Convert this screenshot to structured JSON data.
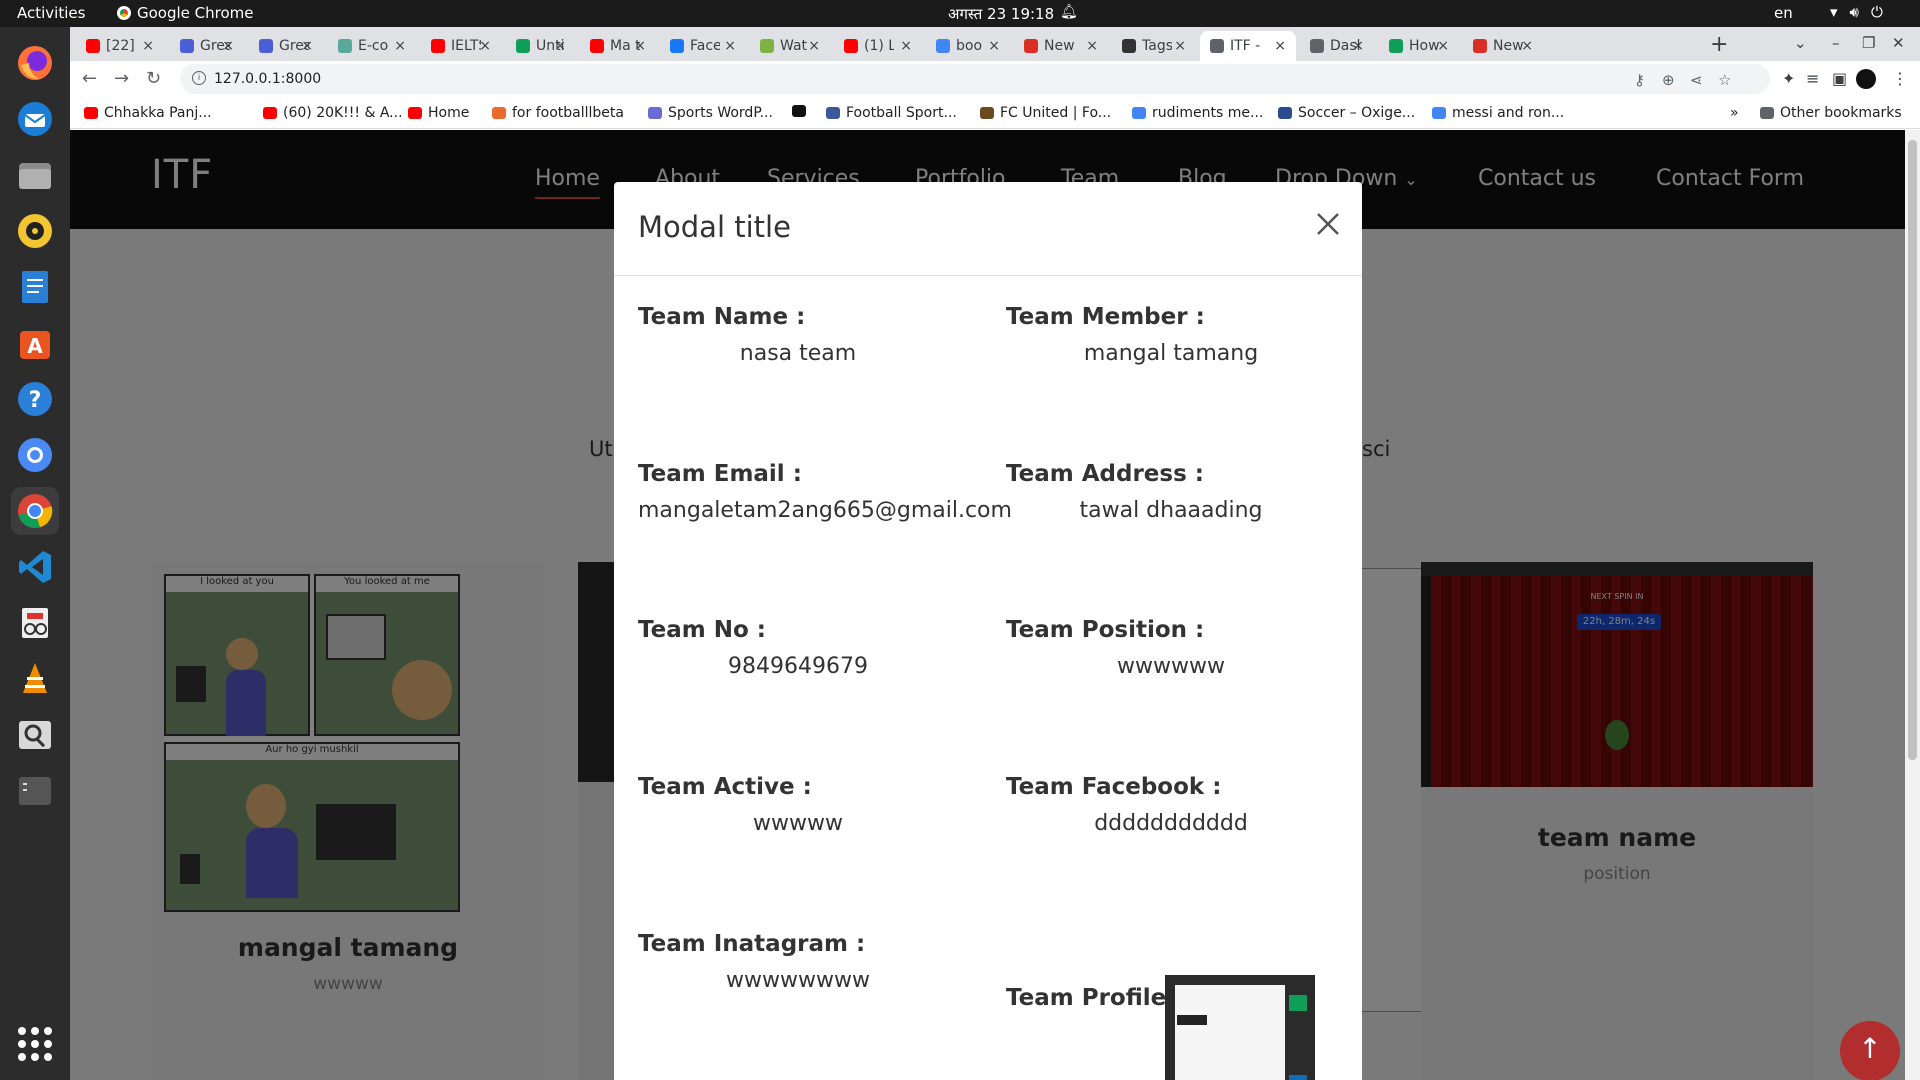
{
  "topbar": {
    "activities": "Activities",
    "app_name": "Google Chrome",
    "clock": "अगस्त 23  19:18",
    "lang": "en"
  },
  "tabs": [
    {
      "label": "[22]",
      "color": "#ff0000"
    },
    {
      "label": "Grea",
      "color": "#4a5fd6"
    },
    {
      "label": "Grea",
      "color": "#4a5fd6"
    },
    {
      "label": "E-co",
      "color": "#5aa89a"
    },
    {
      "label": "IELTS",
      "color": "#ff0000"
    },
    {
      "label": "Unti",
      "color": "#0f9d58"
    },
    {
      "label": "Ma t",
      "color": "#ff0000"
    },
    {
      "label": "Face",
      "color": "#1877f2"
    },
    {
      "label": "Wat",
      "color": "#7cb342"
    },
    {
      "label": "(1) L",
      "color": "#ff0000"
    },
    {
      "label": "boo",
      "color": "#4285f4"
    },
    {
      "label": "New",
      "color": "#d93025"
    },
    {
      "label": "Tags",
      "color": "#333333"
    },
    {
      "label": "ITF -",
      "color": "#5f6368"
    },
    {
      "label": "Dash",
      "color": "#5f6368"
    },
    {
      "label": "How",
      "color": "#0f9d58"
    },
    {
      "label": "New",
      "color": "#d93025"
    }
  ],
  "address": {
    "url": "127.0.0.1:8000"
  },
  "bookmarks": [
    {
      "label": "Chhakka Panj...",
      "color": "#ff0000"
    },
    {
      "label": "(60) 20K!!! & A...",
      "color": "#ff0000"
    },
    {
      "label": "Home",
      "color": "#ff0000"
    },
    {
      "label": "for footballlbeta",
      "color": "#e86a2c"
    },
    {
      "label": "Sports WordP...",
      "color": "#6b6bd6"
    },
    {
      "label": "",
      "color": "#111111"
    },
    {
      "label": "Football Sport...",
      "color": "#3b5998"
    },
    {
      "label": "FC United | Fo...",
      "color": "#6b4a1f"
    },
    {
      "label": "rudiments me...",
      "color": "#4285f4"
    },
    {
      "label": "Soccer – Oxige...",
      "color": "#2a4b8d"
    },
    {
      "label": "messi and ron...",
      "color": "#4285f4"
    }
  ],
  "bookmarks_more": "»",
  "bookmarks_other": "Other bookmarks",
  "site": {
    "logo": "ITF",
    "nav": [
      {
        "label": "Home"
      },
      {
        "label": "About"
      },
      {
        "label": "Services"
      },
      {
        "label": "Portfolio"
      },
      {
        "label": "Team"
      },
      {
        "label": "Blog"
      },
      {
        "label": "Drop Down"
      },
      {
        "label": "Contact us"
      },
      {
        "label": "Contact Form"
      }
    ],
    "section_sub_left": "Ut",
    "section_sub_right": "sci",
    "cards": [
      {
        "name": "mangal tamang",
        "position": "wwwww"
      },
      {
        "name": "",
        "position": ""
      },
      {
        "name": "",
        "position": ""
      },
      {
        "name": "team name",
        "position": "position"
      }
    ]
  },
  "comic": {
    "panel1_caption": "I looked at you",
    "panel2_caption": "You looked at me",
    "panel3_caption": "Aur ho gyi mushkil"
  },
  "spin": {
    "label": "NEXT SPIN IN",
    "timer": "22h, 28m, 24s"
  },
  "modal": {
    "title": "Modal title",
    "fields": {
      "team_name": {
        "label": "Team Name :",
        "value": "nasa team"
      },
      "team_member": {
        "label": "Team Member :",
        "value": "mangal tamang"
      },
      "team_email": {
        "label": "Team Email :",
        "value": "mangaletam2ang665@gmail.com"
      },
      "team_address": {
        "label": "Team Address :",
        "value": "tawal dhaaading"
      },
      "team_no": {
        "label": "Team No :",
        "value": "9849649679"
      },
      "team_position": {
        "label": "Team Position :",
        "value": "wwwwww"
      },
      "team_active": {
        "label": "Team Active :",
        "value": "wwwww"
      },
      "team_facebook": {
        "label": "Team Facebook :",
        "value": "ddddddddddd"
      },
      "team_instagram": {
        "label": "Team Inatagram :",
        "value": "wwwwwwww"
      },
      "team_profile": {
        "label": "Team Profile :"
      }
    }
  },
  "colors": {
    "nav_active_underline": "#e04a4a",
    "scroll_top_button": "#b22d2d",
    "site_header": "#111111"
  }
}
